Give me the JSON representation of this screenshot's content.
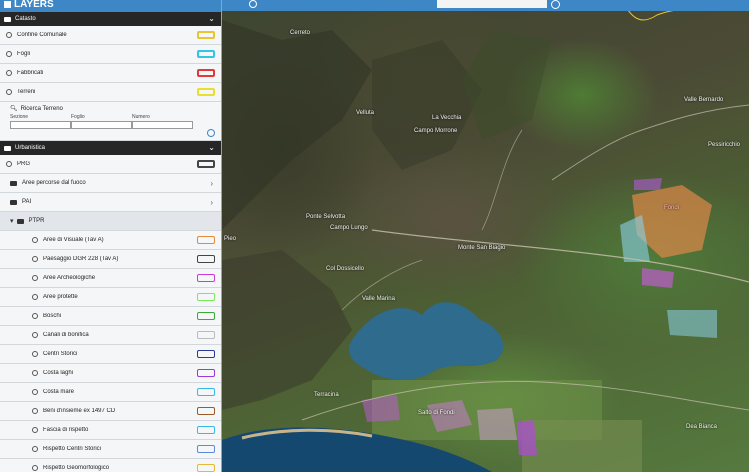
{
  "panel": {
    "title": "LAYERS",
    "sections": {
      "catasto": {
        "label": "Catasto",
        "layers": [
          {
            "label": "Confine Comunale",
            "color": "#e8c531"
          },
          {
            "label": "Fogli",
            "color": "#31c6e8"
          },
          {
            "label": "Fabbricati",
            "color": "#e03a3a"
          },
          {
            "label": "Terreni",
            "color": "#e8e031"
          }
        ],
        "search": {
          "title": "Ricerca Terreno",
          "labels": [
            "Sezione",
            "Foglio",
            "Numero"
          ]
        }
      },
      "urbanistica": {
        "label": "Urbanistica",
        "prg": {
          "label": "PRG",
          "color": "#444444"
        },
        "folders": [
          {
            "label": "Aree percorse dal fuoco"
          },
          {
            "label": "PAI"
          }
        ],
        "ptpr": {
          "label": "PTPR",
          "layers": [
            {
              "label": "Aree di Visuale (Tav A)",
              "color": "#e08a3a"
            },
            {
              "label": "Paesaggio DGR 228 (Tav A)",
              "color": "#444444"
            },
            {
              "label": "Aree Archeologiche",
              "color": "#c93ad9"
            },
            {
              "label": "Aree protette",
              "color": "#7de85a"
            },
            {
              "label": "Boschi",
              "color": "#3aa83a"
            },
            {
              "label": "Canali di bonifica",
              "color": "#bbbbbb"
            },
            {
              "label": "Centri Storici",
              "color": "#2a3a9a"
            },
            {
              "label": "Costa laghi",
              "color": "#9a3ad9"
            },
            {
              "label": "Costa mare",
              "color": "#3ab8e8"
            },
            {
              "label": "Beni d'insieme ex 1497 CD",
              "color": "#9a5a2a"
            },
            {
              "label": "Fascia di rispetto",
              "color": "#3ab8e8"
            },
            {
              "label": "Rispetto Centri Storici",
              "color": "#5a8ad9"
            },
            {
              "label": "Rispetto Geomorfologico",
              "color": "#e8b83a"
            }
          ]
        }
      }
    }
  },
  "map": {
    "places": [
      {
        "name": "Cerreto"
      },
      {
        "name": "Valle Bernardo"
      },
      {
        "name": "Pessiricchio"
      },
      {
        "name": "Velluta"
      },
      {
        "name": "La Vecchia"
      },
      {
        "name": "Campo Morrone"
      },
      {
        "name": "Ponte Selvotta"
      },
      {
        "name": "Campo Lungo"
      },
      {
        "name": "Col Dossicello"
      },
      {
        "name": "Monte San Biagio"
      },
      {
        "name": "Valle Marina"
      },
      {
        "name": "Fondi"
      },
      {
        "name": "Dea Bianca"
      },
      {
        "name": "Salto di Fondi"
      },
      {
        "name": "Terracina"
      },
      {
        "name": "Pieo"
      }
    ]
  }
}
